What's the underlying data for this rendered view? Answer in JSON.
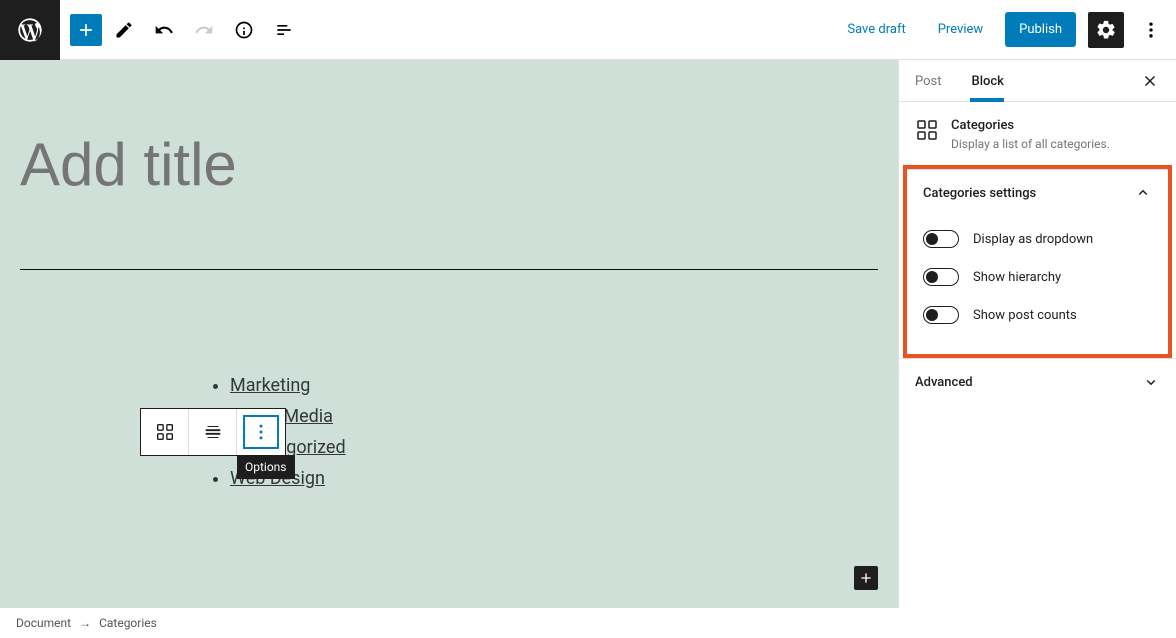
{
  "toolbar": {
    "save_draft": "Save draft",
    "preview": "Preview",
    "publish": "Publish"
  },
  "editor": {
    "title_placeholder": "Add title",
    "block_toolbar_tooltip": "Options",
    "categories": [
      "Marketing",
      "Social Media",
      "Uncategorized",
      "Web Design"
    ]
  },
  "sidebar": {
    "tabs": {
      "post": "Post",
      "block": "Block"
    },
    "block_name": "Categories",
    "block_description": "Display a list of all categories.",
    "panel_settings_title": "Categories settings",
    "toggles": {
      "dropdown": "Display as dropdown",
      "hierarchy": "Show hierarchy",
      "counts": "Show post counts"
    },
    "panel_advanced_title": "Advanced"
  },
  "breadcrumb": {
    "document": "Document",
    "arrow": "→",
    "current": "Categories"
  }
}
